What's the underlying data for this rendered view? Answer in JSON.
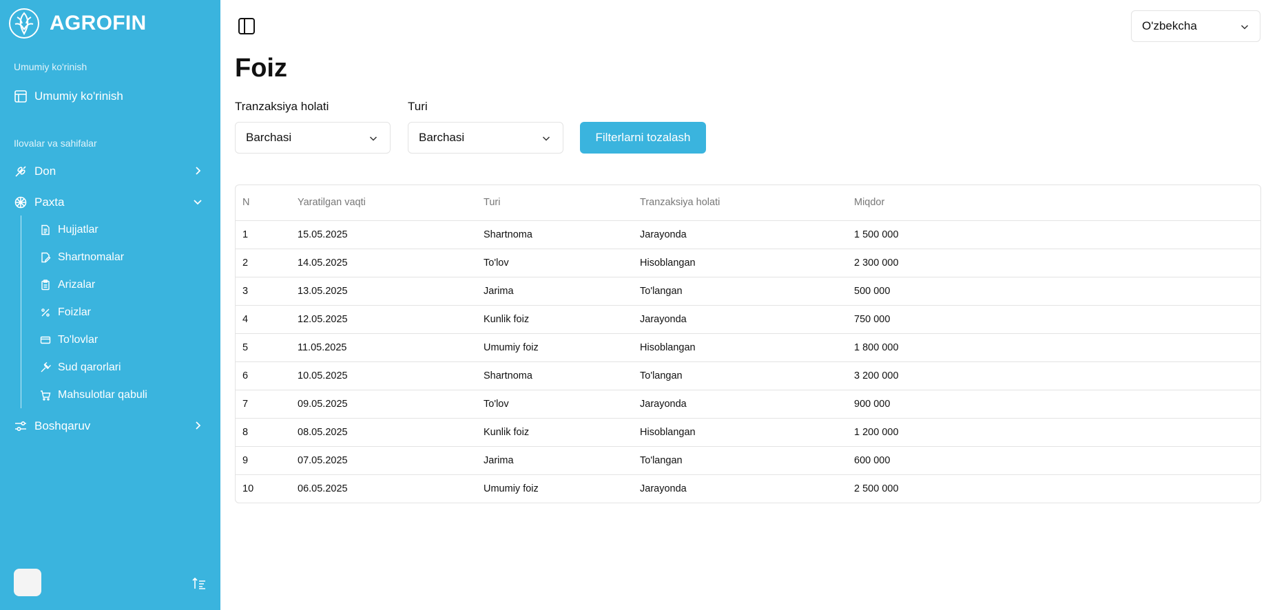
{
  "sidebar": {
    "brand": "AGROFIN",
    "section_overview": "Umumiy ko'rinish",
    "overview_item": "Umumiy ko'rinish",
    "section_apps": "Ilovalar va sahifalar",
    "don": "Don",
    "paxta": "Paxta",
    "sub_items": [
      "Hujjatlar",
      "Shartnomalar",
      "Arizalar",
      "Foizlar",
      "To'lovlar",
      "Sud qarorlari",
      "Mahsulotlar qabuli"
    ],
    "boshqaruv": "Boshqaruv"
  },
  "header": {
    "language": "O'zbekcha"
  },
  "page": {
    "title": "Foiz"
  },
  "filters": {
    "status_label": "Tranzaksiya holati",
    "status_value": "Barchasi",
    "type_label": "Turi",
    "type_value": "Barchasi",
    "clear_label": "Filterlarni tozalash"
  },
  "table": {
    "headers": [
      "N",
      "Yaratilgan vaqti",
      "Turi",
      "Tranzaksiya holati",
      "Miqdor"
    ],
    "rows": [
      [
        "1",
        "15.05.2025",
        "Shartnoma",
        "Jarayonda",
        "1 500 000"
      ],
      [
        "2",
        "14.05.2025",
        "To'lov",
        "Hisoblangan",
        "2 300 000"
      ],
      [
        "3",
        "13.05.2025",
        "Jarima",
        "To'langan",
        "500 000"
      ],
      [
        "4",
        "12.05.2025",
        "Kunlik foiz",
        "Jarayonda",
        "750 000"
      ],
      [
        "5",
        "11.05.2025",
        "Umumiy foiz",
        "Hisoblangan",
        "1 800 000"
      ],
      [
        "6",
        "10.05.2025",
        "Shartnoma",
        "To'langan",
        "3 200 000"
      ],
      [
        "7",
        "09.05.2025",
        "To'lov",
        "Jarayonda",
        "900 000"
      ],
      [
        "8",
        "08.05.2025",
        "Kunlik foiz",
        "Hisoblangan",
        "1 200 000"
      ],
      [
        "9",
        "07.05.2025",
        "Jarima",
        "To'langan",
        "600 000"
      ],
      [
        "10",
        "06.05.2025",
        "Umumiy foiz",
        "Jarayonda",
        "2 500 000"
      ]
    ]
  },
  "colors": {
    "brand": "#3ab4de",
    "border": "#e3e3e3"
  }
}
